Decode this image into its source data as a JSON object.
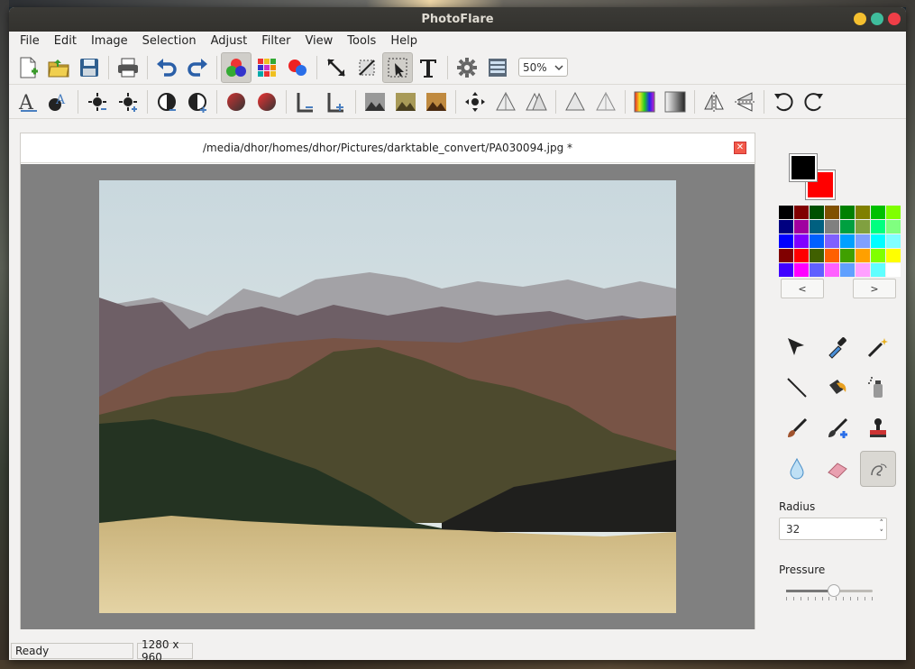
{
  "window": {
    "title": "PhotoFlare"
  },
  "menu": [
    "File",
    "Edit",
    "Image",
    "Selection",
    "Adjust",
    "Filter",
    "View",
    "Tools",
    "Help"
  ],
  "zoom": {
    "value": "50%"
  },
  "document": {
    "path": "/media/dhor/homes/dhor/Pictures/darktable_convert/PA030094.jpg *"
  },
  "colors": {
    "foreground": "#000000",
    "background": "#ff0000",
    "palette": [
      "#000000",
      "#800000",
      "#005000",
      "#805000",
      "#008000",
      "#808000",
      "#00c000",
      "#80ff00",
      "#000080",
      "#a000a0",
      "#006080",
      "#808080",
      "#00a040",
      "#80a040",
      "#00ff80",
      "#80ff80",
      "#0000ff",
      "#8000ff",
      "#0060ff",
      "#8060ff",
      "#00a0ff",
      "#80a0ff",
      "#00ffff",
      "#80ffff",
      "#800000",
      "#ff0000",
      "#406000",
      "#ff6000",
      "#40a000",
      "#ffa000",
      "#80ff00",
      "#ffff00",
      "#4000ff",
      "#ff00ff",
      "#6060ff",
      "#ff60ff",
      "#60a0ff",
      "#ffa0ff",
      "#60ffff",
      "#ffffff"
    ],
    "prev_label": "<",
    "next_label": ">"
  },
  "tool_options": {
    "radius_label": "Radius",
    "radius_value": "32",
    "pressure_label": "Pressure",
    "pressure_fraction": 0.55
  },
  "status": {
    "text": "Ready",
    "dimensions": "1280 x 960"
  }
}
